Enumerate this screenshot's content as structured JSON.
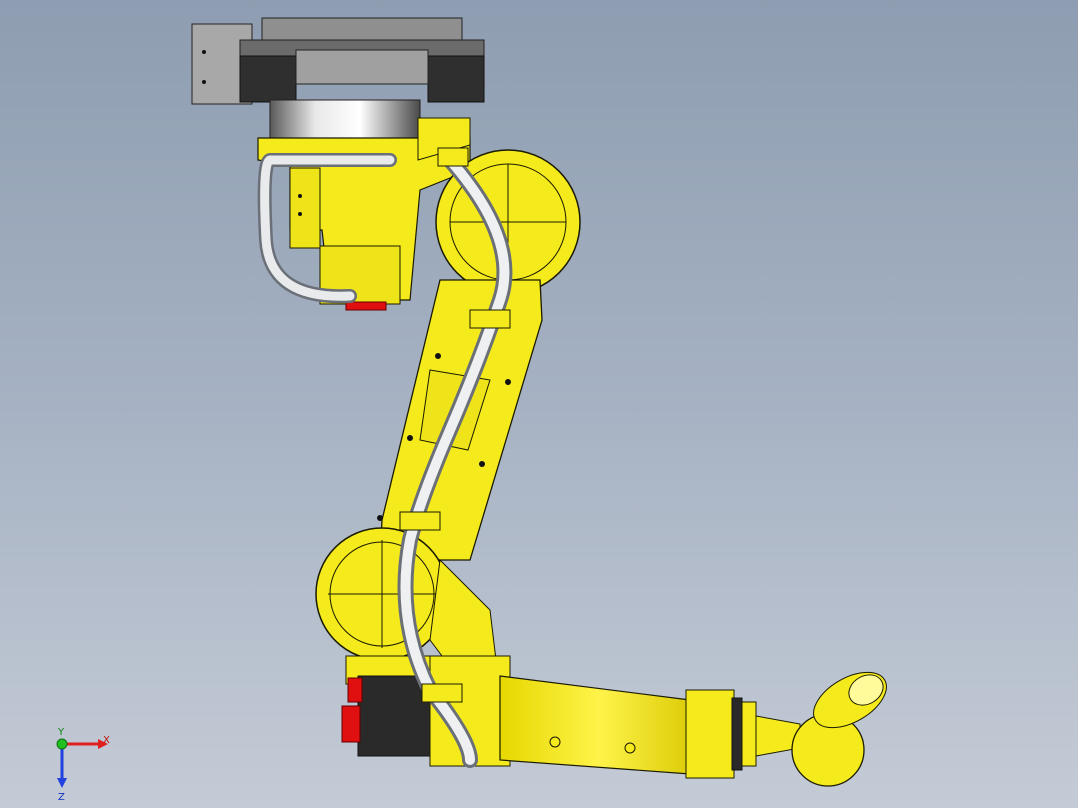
{
  "viewport": {
    "background_top": "#8e9db1",
    "background_bottom": "#c4cbd6"
  },
  "model": {
    "body_color": "#f5ea1c",
    "body_outline": "#1a1a00",
    "cable_color": "#d9dde2",
    "motor_color": "#2a2a2a",
    "accent_red": "#e01010",
    "base_gray": "#9a9a9a"
  },
  "triad": {
    "x_label": "X",
    "y_label": "Y",
    "z_label": "Z",
    "x_color": "#e02020",
    "y_color": "#20c020",
    "z_color": "#2040e0"
  }
}
